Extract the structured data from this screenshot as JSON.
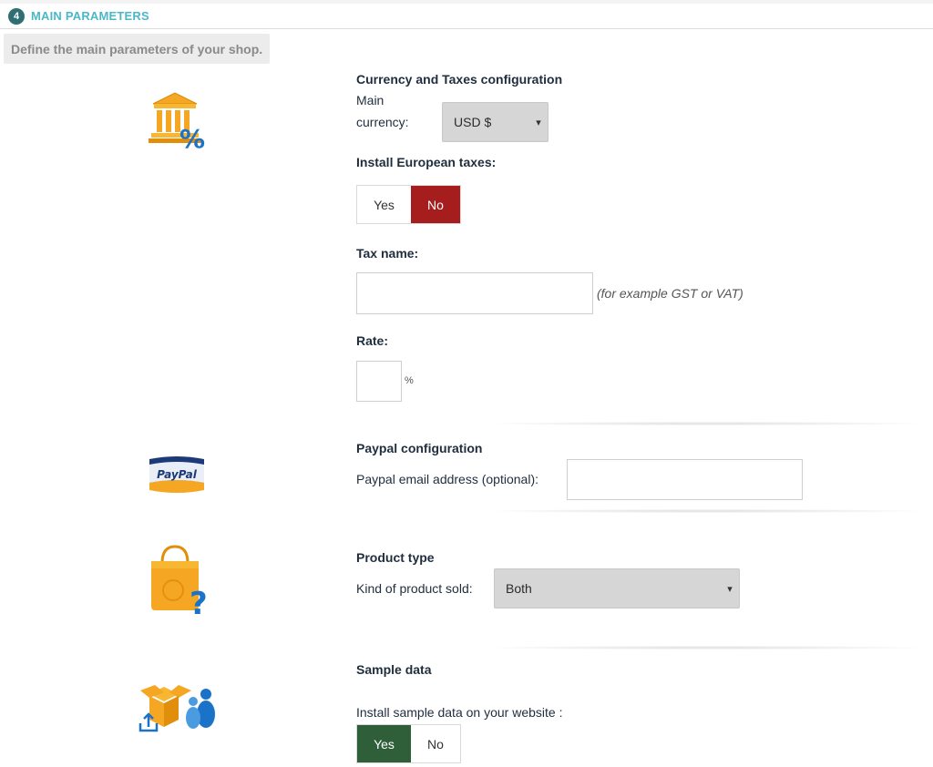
{
  "header": {
    "step_number": "4",
    "title": "MAIN PARAMETERS"
  },
  "description": "Define the main parameters of your shop.",
  "currency": {
    "section_title": "Currency and Taxes configuration",
    "label_line1": "Main",
    "label_line2": "currency:",
    "selected": "USD $"
  },
  "taxes": {
    "label": "Install European taxes:",
    "yes": "Yes",
    "no": "No",
    "selected": "No"
  },
  "tax_name": {
    "label": "Tax name:",
    "value": "",
    "hint": "(for example GST or VAT)"
  },
  "rate": {
    "label": "Rate:",
    "value": "",
    "unit": "%"
  },
  "paypal": {
    "section_title": "Paypal configuration",
    "label": "Paypal email address (optional):",
    "value": "",
    "logo_text": "PayPal"
  },
  "product": {
    "section_title": "Product type",
    "label": "Kind of product sold:",
    "selected": "Both"
  },
  "sample": {
    "section_title": "Sample data",
    "label": "Install sample data on your website :",
    "yes": "Yes",
    "no": "No",
    "selected": "Yes"
  },
  "colors": {
    "accent": "#4ab8c9",
    "step_badge": "#2f6f73",
    "no_active": "#a61d1d",
    "yes_active": "#2e5f38"
  },
  "icons": [
    "bank-percent-icon",
    "paypal-logo-icon",
    "shopping-bag-question-icon",
    "box-users-icon"
  ]
}
